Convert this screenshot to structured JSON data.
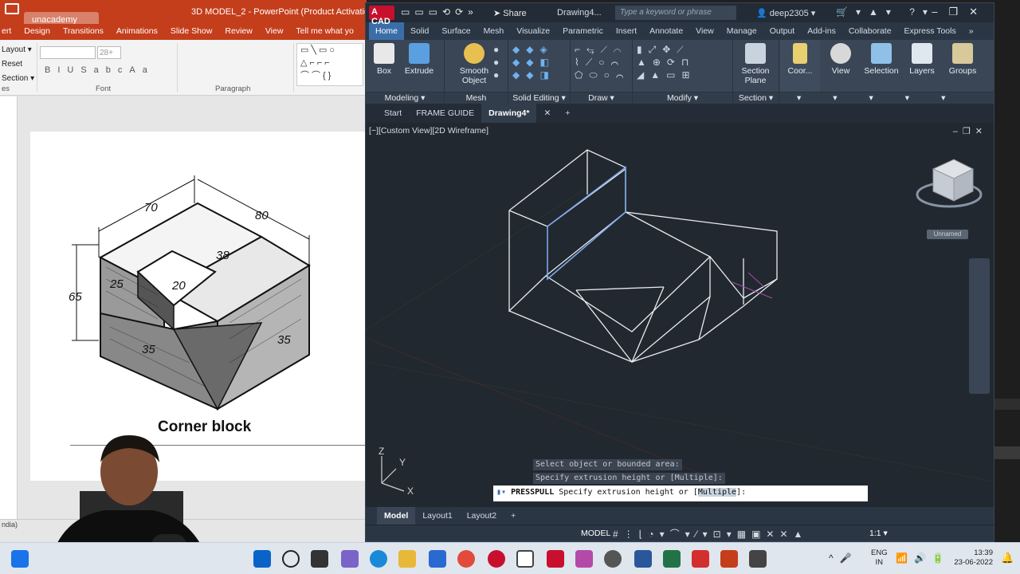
{
  "powerpoint": {
    "title": "3D MODEL_2 - PowerPoint (Product Activation Fai",
    "watermark": "unacademy",
    "tabs": [
      "ert",
      "Design",
      "Transitions",
      "Animations",
      "Slide Show",
      "Review",
      "View",
      "Tell me what yo"
    ],
    "ribbon": {
      "layout": "Layout ▾",
      "reset": "Reset",
      "section": "Section ▾",
      "font_size": "28+",
      "font_group": "Font",
      "paragraph_group": "Paragraph",
      "es": "es"
    },
    "slide": {
      "caption": "Corner block",
      "dims": [
        "70",
        "80",
        "38",
        "65",
        "25",
        "20",
        "35",
        "35"
      ]
    },
    "status": "ndia)",
    "status_right": "N"
  },
  "autocad": {
    "logo": "A CAD",
    "share": "Share",
    "doc_name": "Drawing4...",
    "search_placeholder": "Type a keyword or phrase",
    "user": "deep2305",
    "menu_tabs": [
      "Home",
      "Solid",
      "Surface",
      "Mesh",
      "Visualize",
      "Parametric",
      "Insert",
      "Annotate",
      "View",
      "Manage",
      "Output",
      "Add-ins",
      "Collaborate",
      "Express Tools",
      "»"
    ],
    "active_menu_tab": "Home",
    "ribbon_buttons": {
      "box": "Box",
      "extrude": "Extrude",
      "smooth_object_1": "Smooth",
      "smooth_object_2": "Object",
      "section_plane_1": "Section",
      "section_plane_2": "Plane",
      "coordinates": "Coor...",
      "view": "View",
      "selection": "Selection",
      "layers": "Layers",
      "groups": "Groups"
    },
    "ribbon_panels": [
      "Modeling ▾",
      "Mesh",
      "Solid Editing ▾",
      "Draw ▾",
      "Modify ▾",
      "Section ▾"
    ],
    "file_tabs": [
      "Start",
      "FRAME GUIDE",
      "Drawing4*"
    ],
    "active_file_tab": "Drawing4*",
    "viewport_label": "[−][Custom View][2D Wireframe]",
    "viewcube_label": "Unnamed",
    "ucs": {
      "z": "Z",
      "y": "Y",
      "x": "X"
    },
    "command_history": [
      "Select object or bounded area:",
      "Specify extrusion height or [Multiple]:"
    ],
    "command_line": {
      "command": "PRESSPULL",
      "prompt": " Specify extrusion height or [",
      "option": "Multiple",
      "suffix": "]:"
    },
    "layout_tabs": [
      "Model",
      "Layout1",
      "Layout2"
    ],
    "active_layout_tab": "Model",
    "status_model": "MODEL",
    "status_scale": "1:1 ▾"
  },
  "taskbar": {
    "lang_1": "ENG",
    "lang_2": "IN",
    "time": "13:39",
    "date": "23-06-2022"
  }
}
